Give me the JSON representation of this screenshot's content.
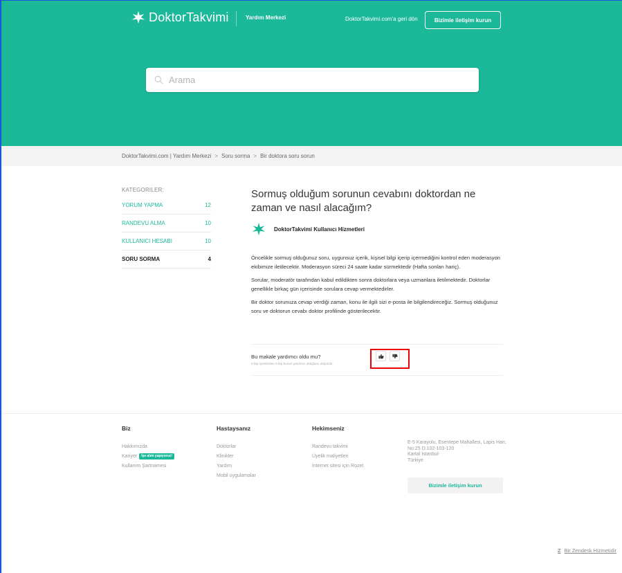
{
  "header": {
    "brand": "DoktorTakvimi",
    "help_center": "Yardım Merkezi",
    "back_link": "DoktorTakvimi.com'a geri dön",
    "contact_button": "Bizimle iletişim kurun"
  },
  "search": {
    "placeholder": "Arama"
  },
  "breadcrumb": {
    "items": [
      "DoktorTakvimi.com | Yardım Merkezi",
      "Soru sorma",
      "Bir doktora soru sorun"
    ],
    "separator": ">"
  },
  "sidebar": {
    "title": "KATEGORILER:",
    "items": [
      {
        "label": "YORUM YAPMA",
        "count": "12"
      },
      {
        "label": "RANDEVU ALMA",
        "count": "10"
      },
      {
        "label": "KULLANICI HESABI",
        "count": "10"
      },
      {
        "label": "SORU SORMA",
        "count": "4"
      }
    ]
  },
  "article": {
    "title": "Sormuş olduğum sorunun cevabını doktordan ne zaman ve nasıl alacağım?",
    "author": "DoktorTakvimi Kullanıcı Hizmetleri",
    "paragraphs": [
      "Öncelikle sormuş olduğunuz soru, uygunsuz içerik, kişisel bilgi içerip içermediğini kontrol eden moderasyon ekibimize iletilecektir. Moderasyon süreci 24 saate kadar sürmektedir (Hafta sonları hariç).",
      "Sorular, moderatör tarafından kabul edildikten sonra doktorlara veya uzmanlara iletilmektedir. Doktorlar genellikle birkaç gün içerisinde sorulara cevap vermektedirler.",
      "Bir doktor sorunuza cevap verdiği zaman, konu ile ilgili sizi e-posta ile bilgilendireceğiz. Sormuş olduğunuz soru ve doktorun cevabı doktor profilinde gösterilecektir."
    ]
  },
  "vote": {
    "question": "Bu makale yardımcı oldu mu?",
    "count_text": "0 kişi içerisinden 0 kişi bunun yardımcı olduğunu düşündü"
  },
  "footer": {
    "columns": [
      {
        "title": "Biz",
        "links": [
          "Hakkımızda",
          "Kariyer",
          "Kullanım Şartnamesi"
        ]
      },
      {
        "title": "Hastaysanız",
        "links": [
          "Doktorlar",
          "Klinikler",
          "Yardım",
          "Mobil uygulamalar"
        ]
      },
      {
        "title": "Hekimseniz",
        "links": [
          "Randevu takvimi",
          "Üyelik maliyetleri",
          "İnternet sitesi için Rozet"
        ]
      }
    ],
    "hiring_badge": "İşe alım yapıyoruz!",
    "address": [
      "E-5 Karayolu, Esentepe Mahallesi, Lapis Han, No:25 D:102-103-120",
      "Kartal İstanbul",
      "Türkiye"
    ],
    "contact_button": "Bizimle iletişim kurun",
    "zendesk": "Bir Zendesk Hizmetidir"
  },
  "colors": {
    "brand": "#1bb89a",
    "highlight": "#ee0000"
  }
}
